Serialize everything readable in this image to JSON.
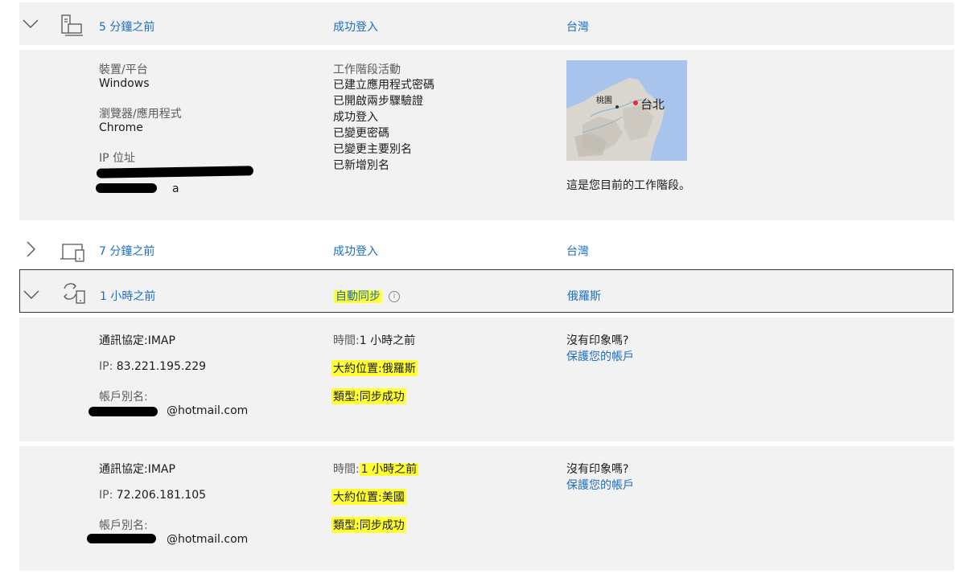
{
  "rows": [
    {
      "time": "5 分鐘之前",
      "status": "成功登入",
      "location": "台灣",
      "details": {
        "activity_title": "工作階段活動",
        "activities": [
          "已建立應用程式密碼",
          "已開啟兩步驟驗證",
          "成功登入",
          "已變更密碼",
          "已變更主要別名",
          "已新增別名"
        ],
        "device_label": "裝置/平台",
        "device_value": "Windows",
        "browser_label": "瀏覽器/應用程式",
        "browser_value": "Chrome",
        "ip_label": "IP 位址",
        "ip_line2_visible": "a",
        "map_city_main": "台北",
        "map_city_secondary": "桃園",
        "current_session_note": "這是您目前的工作階段。"
      }
    },
    {
      "time": "7 分鐘之前",
      "status": "成功登入",
      "location": "台灣"
    },
    {
      "time": "1 小時之前",
      "status": "自動同步",
      "location": "俄羅斯",
      "details": [
        {
          "protocol": "通訊協定:IMAP",
          "ip_label": "IP:",
          "ip_value": "83.221.195.229",
          "alias_label": "帳戶別名:",
          "alias_suffix": "@hotmail.com",
          "time_label": "時間:",
          "time_value": "1 小時之前",
          "loc_label": "大約位置:",
          "loc_value": "俄羅斯",
          "type_label": "類型:",
          "type_value": "同步成功",
          "question": "沒有印象嗎?",
          "protect_link": "保護您的帳戶"
        },
        {
          "protocol": "通訊協定:IMAP",
          "ip_label": "IP:",
          "ip_value": "72.206.181.105",
          "alias_label": "帳戶別名:",
          "alias_suffix": "@hotmail.com",
          "time_label": "時間:",
          "time_value": "1 小時之前",
          "loc_label": "大約位置:",
          "loc_value": "美國",
          "type_label": "類型:",
          "type_value": "同步成功",
          "question": "沒有印象嗎?",
          "protect_link": "保護您的帳戶"
        }
      ]
    }
  ],
  "icons": {
    "expanded": "chevron-down-icon",
    "collapsed": "chevron-right-icon",
    "device_desktop": "desktop-computer-icon",
    "device_tablet": "tablet-device-icon",
    "sync": "sync-device-icon",
    "info": "info-icon"
  },
  "colors": {
    "link": "#1b6ec2",
    "band": "#f2f2f2",
    "highlight": "#ffff33"
  }
}
